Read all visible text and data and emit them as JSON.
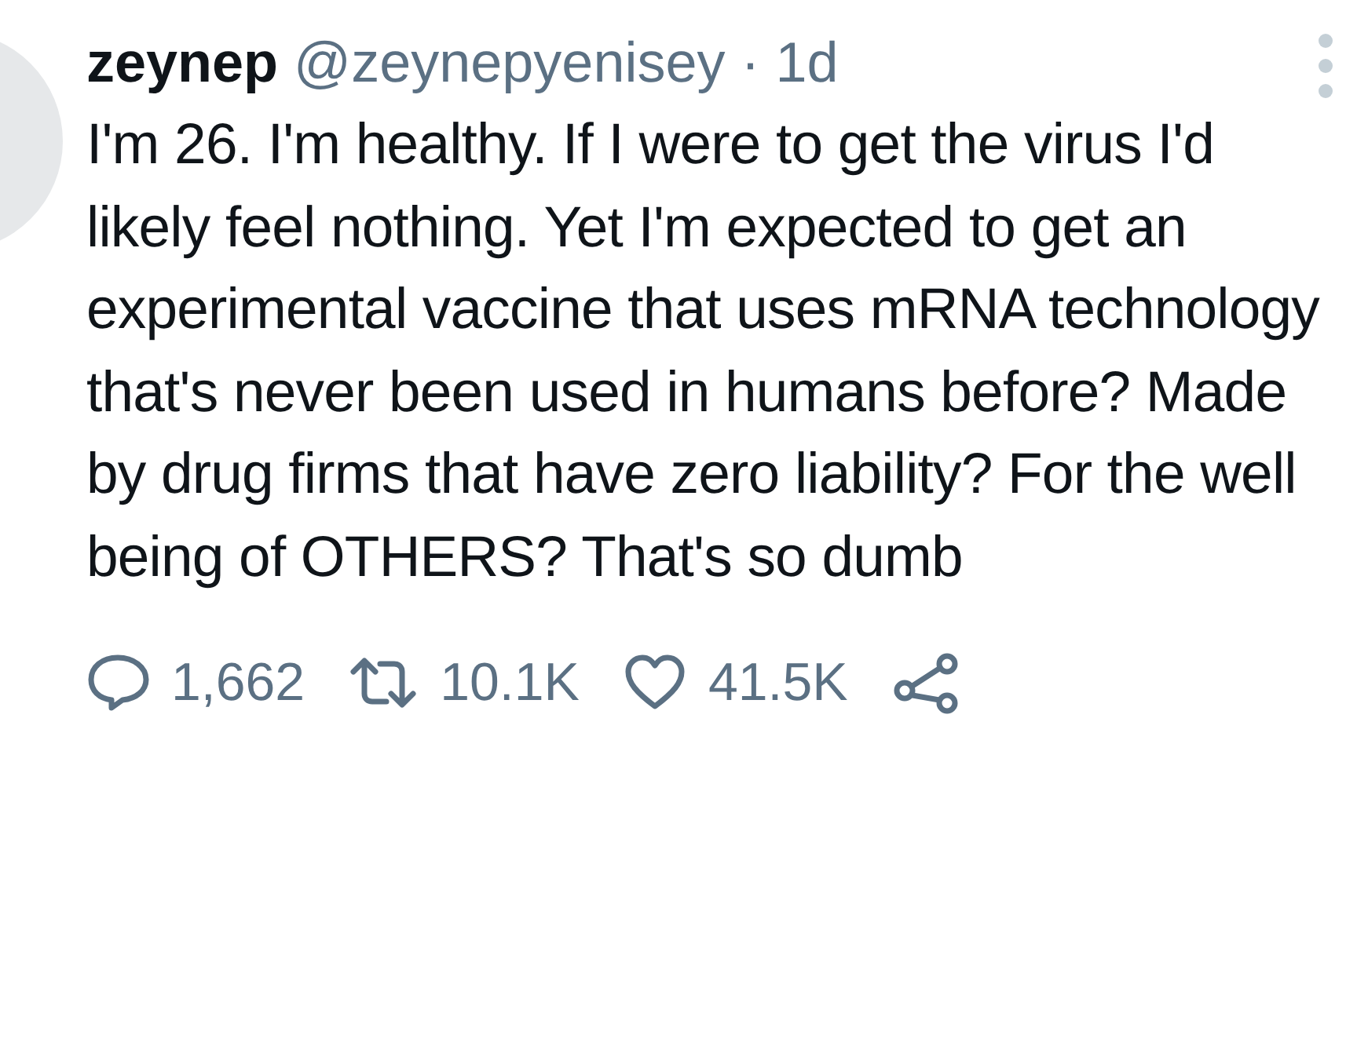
{
  "tweet": {
    "name": "zeynep",
    "handle": "@zeynepyenisey",
    "separator": "·",
    "time": "1d",
    "text": "I'm 26. I'm healthy. If I were to get the virus I'd likely feel nothing. Yet I'm expected to get an experimental vaccine that uses mRNA technology that's never been used in humans before? Made by drug firms that have zero liability? For the well being of OTHERS? That's so dumb"
  },
  "actions": [
    {
      "kind": "reply",
      "count": "1,662"
    },
    {
      "kind": "retweet",
      "count": "10.1K"
    },
    {
      "kind": "like",
      "count": "41.5K"
    },
    {
      "kind": "share"
    }
  ]
}
